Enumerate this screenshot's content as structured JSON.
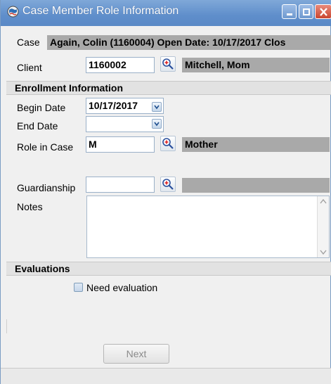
{
  "window": {
    "title": "Case Member Role Information",
    "app_icon": "app-globe-icon",
    "controls": {
      "minimize_icon": "minimize-icon",
      "maximize_icon": "maximize-icon",
      "close_icon": "close-icon"
    }
  },
  "case": {
    "label": "Case",
    "value": "Again, Colin (1160004) Open Date: 10/17/2017 Clos"
  },
  "client": {
    "label": "Client",
    "id_value": "1160002",
    "name_value": "Mitchell, Mom",
    "lookup_icon": "magnifier-icon"
  },
  "enrollment": {
    "header": "Enrollment Information",
    "begin_date": {
      "label": "Begin Date",
      "value": "10/17/2017"
    },
    "end_date": {
      "label": "End Date",
      "value": ""
    },
    "role": {
      "label": "Role in Case",
      "code": "M",
      "description": "Mother"
    },
    "guardianship": {
      "label": "Guardianship",
      "code": "",
      "description": ""
    },
    "notes": {
      "label": "Notes",
      "value": ""
    }
  },
  "evaluations": {
    "header": "Evaluations",
    "need_evaluation": {
      "label": "Need evaluation",
      "checked": false
    }
  },
  "actions": {
    "next_label": "Next"
  },
  "colors": {
    "title_bar": "#5f8ecb",
    "readonly_fill": "#a9a9a9",
    "section_header": "#e2e2e2",
    "close_button": "#c9452f"
  }
}
